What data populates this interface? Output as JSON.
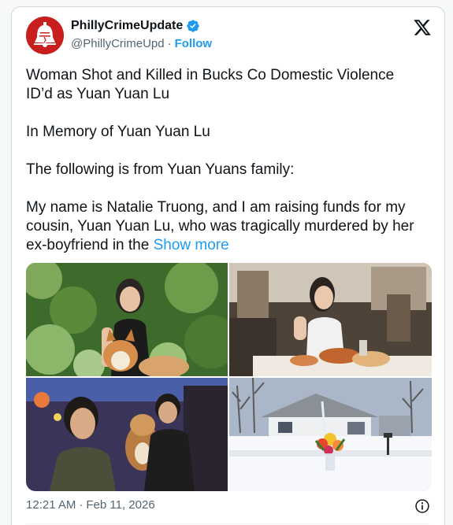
{
  "account": {
    "display_name": "PhillyCrimeUpdate",
    "handle": "@PhillyCrimeUpd",
    "separator": "·",
    "follow_label": "Follow"
  },
  "tweet": {
    "line1": "Woman Shot and Killed in Bucks Co Domestic Violence",
    "line2": "ID’d as Yuan Yuan Lu",
    "line3": "In Memory of Yuan Yuan Lu",
    "line4": "The following is from Yuan Yuans family:",
    "line5": "My name is Natalie Truong, and I am raising funds for my",
    "line6": "cousin, Yuan Yuan Lu, who was tragically murdered by her",
    "line7": "ex-boyfriend in the",
    "show_more": "Show more"
  },
  "footer": {
    "time": "12:21 AM",
    "separator": "·",
    "date": "Feb 11, 2026"
  },
  "icons": {
    "verified": "verified-badge-icon",
    "x_logo": "x-logo-icon",
    "info": "info-icon"
  },
  "colors": {
    "accent": "#1d9bf0",
    "avatar_red": "#d21f1f",
    "secondary_text": "#536471"
  }
}
